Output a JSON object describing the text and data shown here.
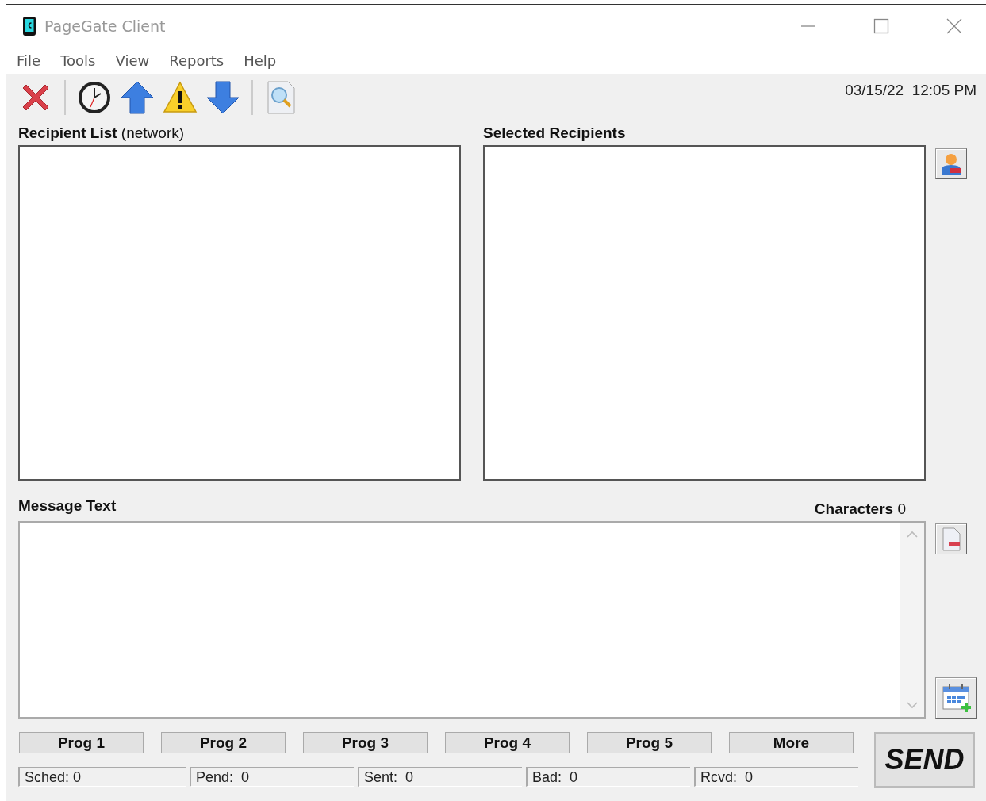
{
  "window": {
    "title": "PageGate Client"
  },
  "menu": [
    "File",
    "Tools",
    "View",
    "Reports",
    "Help"
  ],
  "datetime": "03/15/22  12:05 PM",
  "recipient_list": {
    "heading": "**Recipient List** (network)"
  },
  "selected_recipients": {
    "heading": "Selected Recipients"
  },
  "message": {
    "heading": "Message Text",
    "characters": "**Characters** 0"
  },
  "prog_buttons": [
    "Prog 1",
    "Prog 2",
    "Prog 3",
    "Prog 4",
    "Prog 5",
    "More"
  ],
  "status_fields": [
    "Sched: 0",
    "Pend:  0",
    "Sent:  0",
    "Bad:  0",
    "Rcvd:  0"
  ],
  "send_button": "SEND"
}
